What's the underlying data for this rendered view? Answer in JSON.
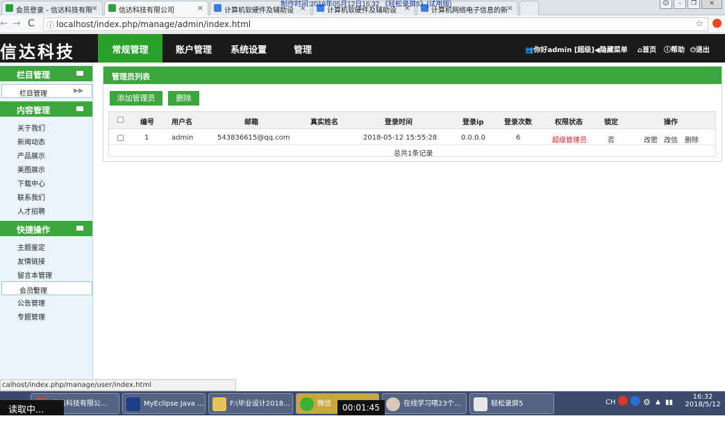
{
  "browser": {
    "recording_banner": "制作时间:2018年05月12日16:32 《轻松录屏5》[试用版]",
    "tabs": [
      {
        "title": "会员登录 - 信达科技有限",
        "close": "×"
      },
      {
        "title": "信达科技有限公司",
        "close": "×"
      },
      {
        "title": "计算机软硬件及辅助设",
        "close": "×"
      },
      {
        "title": "计算机软硬件及辅助设",
        "close": "×"
      },
      {
        "title": "计算机网络电子信息的新",
        "close": "×"
      }
    ],
    "url": "localhost/index.php/manage/admin/index.html",
    "status_url": "calhost/index.php/manage/user/index.html"
  },
  "header": {
    "logo": "信达科技",
    "menu": [
      "常规管理",
      "账户管理",
      "系统设置",
      "管理"
    ],
    "greeting": "你好admin",
    "role": "[超级]",
    "hide_menu": "隐藏菜单",
    "home": "首页",
    "help": "帮助",
    "logout": "退出"
  },
  "sidebar": {
    "sections": [
      {
        "title": "栏目管理",
        "items": [
          "栏目管理"
        ]
      },
      {
        "title": "内容管理",
        "items": [
          "关于我们",
          "新闻动态",
          "产品展示",
          "美图展示",
          "下载中心",
          "联系我们",
          "人才招聘"
        ]
      },
      {
        "title": "快捷操作",
        "items": [
          "主题鉴定",
          "友情链接",
          "留言本管理",
          "会员管理",
          "公告管理",
          "专题管理"
        ]
      }
    ]
  },
  "main": {
    "panel_title": "管理员列表",
    "add_button": "添加管理员",
    "delete_button": "删除",
    "columns": [
      "编号",
      "用户名",
      "邮箱",
      "真实姓名",
      "登录时间",
      "登录ip",
      "登录次数",
      "权限状态",
      "锁定",
      "操作"
    ],
    "rows": [
      {
        "id": "1",
        "username": "admin",
        "email": "543836615@qq.com",
        "realname": "",
        "login_time": "2018-05-12 15:55:28",
        "ip": "0.0.0.0",
        "count": "6",
        "role": "超级管理员",
        "locked": "否",
        "actions": [
          "改密",
          "改信",
          "删除"
        ]
      }
    ],
    "footer": "总共1条记录"
  },
  "taskbar": {
    "reading": "读取中...",
    "timer": "00:01:45",
    "items": [
      "信达科技有限公...",
      "MyEclipse Java ...",
      "F:\\毕业设计2018...",
      "微信",
      "在线学习嘻23个...",
      "轻松录屏5"
    ],
    "ime": "CH",
    "time": "16:32",
    "date": "2018/5/12"
  },
  "colors": {
    "green": "#3ca63c",
    "nav_bg": "#1a1a1a",
    "sidebar_bg": "#eaf5fb",
    "role_red": "#d0202a"
  }
}
